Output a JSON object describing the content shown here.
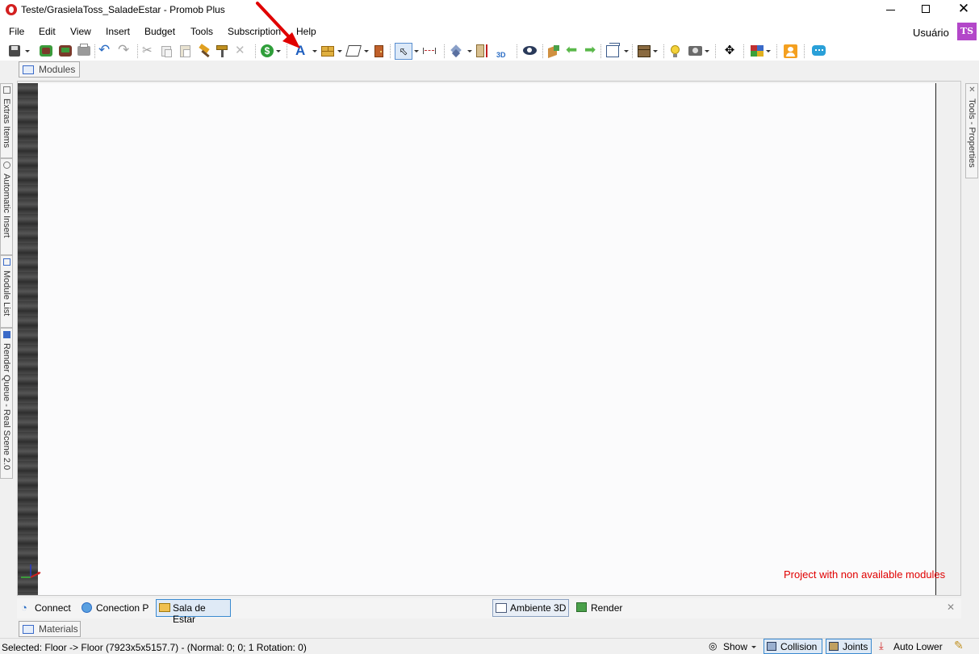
{
  "window": {
    "title": "Teste/GrasielaToss_SaladeEstar - Promob Plus",
    "controls": [
      "minimize",
      "maximize",
      "close"
    ]
  },
  "menu": {
    "items": [
      "File",
      "Edit",
      "View",
      "Insert",
      "Budget",
      "Tools",
      "Subscription",
      "Help"
    ],
    "user_label": "Usuário",
    "avatar_initials": "TS"
  },
  "toolbar": {
    "icons": [
      "save-icon",
      "catalog-icon",
      "budget-print-icon",
      "print-icon",
      "undo-icon",
      "redo-icon",
      "cut-icon",
      "copy-icon",
      "paste-icon",
      "hammer-icon",
      "paint-roller-icon",
      "delete-icon",
      "money-icon",
      "text-icon",
      "bricks-icon",
      "shape-tool-icon",
      "door-icon",
      "select-cursor-icon",
      "dimension-icon",
      "layers-icon",
      "height-icon",
      "3d-icon",
      "eye-icon",
      "paint-bucket-icon",
      "back-arrow-icon",
      "forward-arrow-icon",
      "cube-view-icon",
      "box-icon",
      "light-bulb-icon",
      "camera-icon",
      "move-icon",
      "color-palette-icon",
      "user-icon",
      "chat-icon"
    ]
  },
  "tabs": {
    "modules": "Modules",
    "materials": "Materials"
  },
  "left_panel": {
    "tabs": [
      "Extras Items",
      "Automatic Insert",
      "Module List",
      "Render Queue - Real Scene 2.0"
    ]
  },
  "right_panel": {
    "tab": "Tools - Properties"
  },
  "canvas": {
    "warning": "Project with non available modules",
    "background": "#fbfbfc"
  },
  "bottom_tabs": {
    "left": [
      "Connect",
      "Conection P",
      "Sala de Estar"
    ],
    "active_left": "Sala de Estar",
    "right": [
      "Ambiente 3D",
      "Render"
    ],
    "active_right": "Ambiente 3D"
  },
  "status": {
    "selected": "Selected: Floor -> Floor (7923x5x5157.7) - (Normal: 0; 0; 1 Rotation: 0)",
    "show": "Show",
    "collision": "Collision",
    "joints": "Joints",
    "auto_lower": "Auto Lower"
  },
  "colors": {
    "accent": "#0078d7",
    "warning": "#e00000",
    "avatar": "#b347c9",
    "annotation_arrow": "#e00000"
  }
}
